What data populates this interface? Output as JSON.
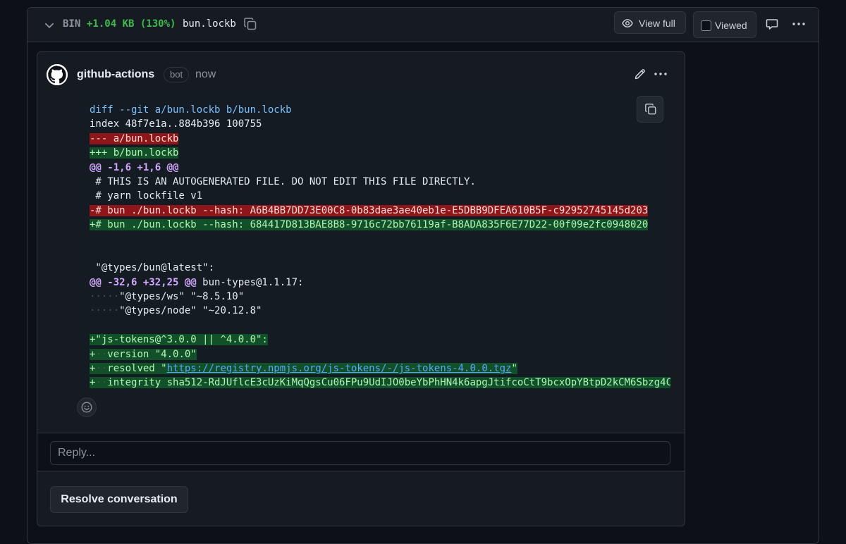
{
  "file_header": {
    "bin_label": "BIN",
    "size_change": "+1.04 KB (130%)",
    "filename": "bun.lockb",
    "view_full_label": "View full",
    "viewed_label": "Viewed"
  },
  "comment": {
    "author": "github-actions",
    "badge": "bot",
    "time": "now",
    "code_lines": {
      "l1": "diff --git a/bun.lockb b/bun.lockb",
      "l2": "index 48f7e1a..884b396 100755",
      "l3": "--- a/bun.lockb",
      "l4": "+++ b/bun.lockb",
      "l5": "@@ -1,6 +1,6 @@",
      "l6": " # THIS IS AN AUTOGENERATED FILE. DO NOT EDIT THIS FILE DIRECTLY.",
      "l7": " # yarn lockfile v1",
      "l8": "-# bun ./bun.lockb --hash: A6B4BB7DD73E00C8-0b83dae3ae40eb1e-E5DBB9DFEA610B5F-c92952745145d203",
      "l9": "+# bun ./bun.lockb --hash: 684417D813BAE8B8-9716c72bb76119af-B8ADA835F6E77D22-00f09e2fc0948020",
      "l12": " \"@types/bun@latest\":",
      "l13_hunk": "@@ -32,6 +32,25 @@",
      "l13_rest": " bun-types@1.1.17:",
      "l14_ws": "·····",
      "l14_text": "\"@types/ws\" \"~8.5.10\"",
      "l15_ws": "·····",
      "l15_text": "\"@types/node\" \"~20.12.8\"",
      "l17": "+\"js-tokens@^3.0.0 || ^4.0.0\":",
      "l18_pre": "+",
      "l18_ws": "··",
      "l18_text": "version \"4.0.0\"",
      "l19_pre": "+",
      "l19_ws": "··",
      "l19_text": "resolved \"",
      "l19_link": "https://registry.npmjs.org/js-tokens/-/js-tokens-4.0.0.tgz",
      "l19_end": "\"",
      "l20_pre": "+",
      "l20_ws": "··",
      "l20_text": "integrity sha512-RdJUflcE3cUzKiMqQgsCu06FPu9UdIJO0beYbPhHN4k6apgJtifcoCtT9bcxOpYBtpD2kCM6Sbzg4C"
    }
  },
  "reply": {
    "placeholder": "Reply..."
  },
  "resolve_label": "Resolve conversation",
  "colors": {
    "background": "#0d1117",
    "addition": "#12502a",
    "deletion": "#8e1519",
    "size_green": "#3fb950",
    "link": "#58a6ff"
  }
}
